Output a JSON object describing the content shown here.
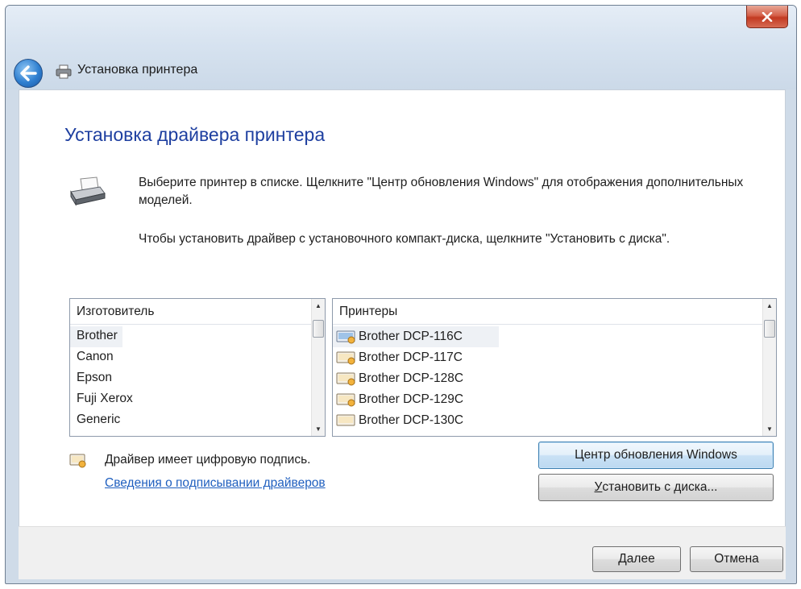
{
  "window": {
    "title": "Установка принтера",
    "close_label": "x"
  },
  "main": {
    "heading": "Установка драйвера принтера",
    "instruction_1": "Выберите принтер в списке. Щелкните \"Центр обновления Windows\" для отображения дополнительных моделей.",
    "instruction_2": "Чтобы установить драйвер с установочного компакт-диска, щелкните \"Установить с диска\"."
  },
  "manufacturers": {
    "header": "Изготовитель",
    "items": [
      "Brother",
      "Canon",
      "Epson",
      "Fuji Xerox",
      "Generic"
    ],
    "selected": "Brother"
  },
  "printers": {
    "header": "Принтеры",
    "items": [
      "Brother DCP-116C",
      "Brother DCP-117C",
      "Brother DCP-128C",
      "Brother DCP-129C",
      "Brother DCP-130C"
    ],
    "selected": "Brother DCP-116C"
  },
  "signature": {
    "text": "Драйвер имеет цифровую подпись.",
    "link": "Сведения о подписывании драйверов"
  },
  "buttons": {
    "windows_update": "Центр обновления Windows",
    "have_disk_prefix": "",
    "have_disk_key": "У",
    "have_disk_rest": "становить с диска...",
    "next_key": "Д",
    "next_rest": "алее",
    "cancel": "Отмена"
  },
  "colors": {
    "heading": "#1e3fa0",
    "link": "#1f5fbf",
    "close_button": "#c23a22"
  },
  "icons": {
    "back": "back-arrow-icon",
    "title": "printer-icon",
    "printer_large": "printer-icon",
    "driver": "printer-driver-icon",
    "signature": "signed-driver-icon"
  }
}
